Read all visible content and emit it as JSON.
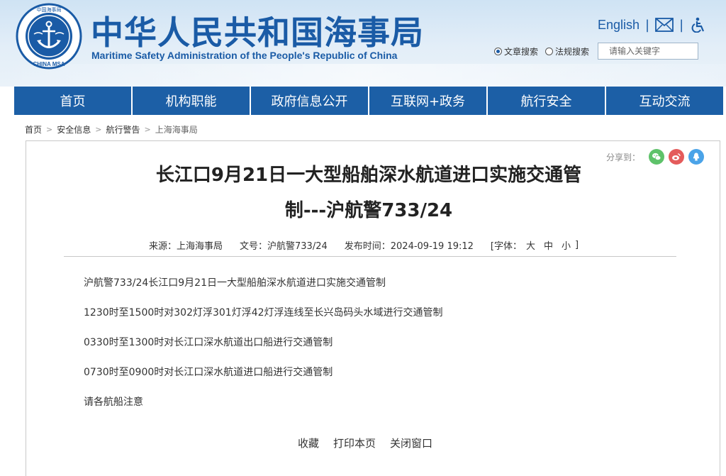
{
  "header": {
    "logo_text_top": "中国海事局",
    "logo_text_bottom": "CHINA MSA",
    "title_cn": "中华人民共和国海事局",
    "title_en": "Maritime Safety Administration of the People's Republic of China",
    "english_link": "English",
    "separator": "|",
    "search": {
      "option_article": "文章搜索",
      "option_law": "法规搜索",
      "placeholder": "请输入关键字"
    }
  },
  "nav": {
    "items": [
      "首页",
      "机构职能",
      "政府信息公开",
      "互联网+政务",
      "航行安全",
      "互动交流"
    ]
  },
  "breadcrumb": {
    "items": [
      "首页",
      "安全信息",
      "航行警告",
      "上海海事局"
    ],
    "arrow": ">"
  },
  "share": {
    "label": "分享到："
  },
  "article": {
    "title_line1": "长江口9月21日一大型船舶深水航道进口实施交通管",
    "title_line2": "制---沪航警733/24",
    "meta": {
      "source": "来源：上海海事局",
      "doc_no": "文号：沪航警733/24",
      "publish_time": "发布时间：2024-09-19 19:12",
      "font_label": "[字体：",
      "font_large": "大",
      "font_medium": "中",
      "font_small": "小",
      "font_end": "]"
    },
    "paragraphs": [
      "沪航警733/24长江口9月21日一大型船舶深水航道进口实施交通管制",
      "1230时至1500时对302灯浮301灯浮42灯浮连线至长兴岛码头水域进行交通管制",
      "0330时至1300时对长江口深水航道出口船进行交通管制",
      "0730时至0900时对长江口深水航道进口船进行交通管制",
      "请各航船注意"
    ]
  },
  "actions": {
    "favorite": "收藏",
    "print": "打印本页",
    "close": "关闭窗口"
  },
  "colors": {
    "brand_blue": "#1a5ba6",
    "nav_blue": "#1c5fa6",
    "wechat_green": "#5ec26a",
    "weibo_red": "#e45b5b",
    "qq_blue": "#4aa3e8"
  },
  "icons": [
    "msa-logo",
    "mail-icon",
    "accessibility-icon",
    "wechat-icon",
    "weibo-icon",
    "qq-icon"
  ]
}
